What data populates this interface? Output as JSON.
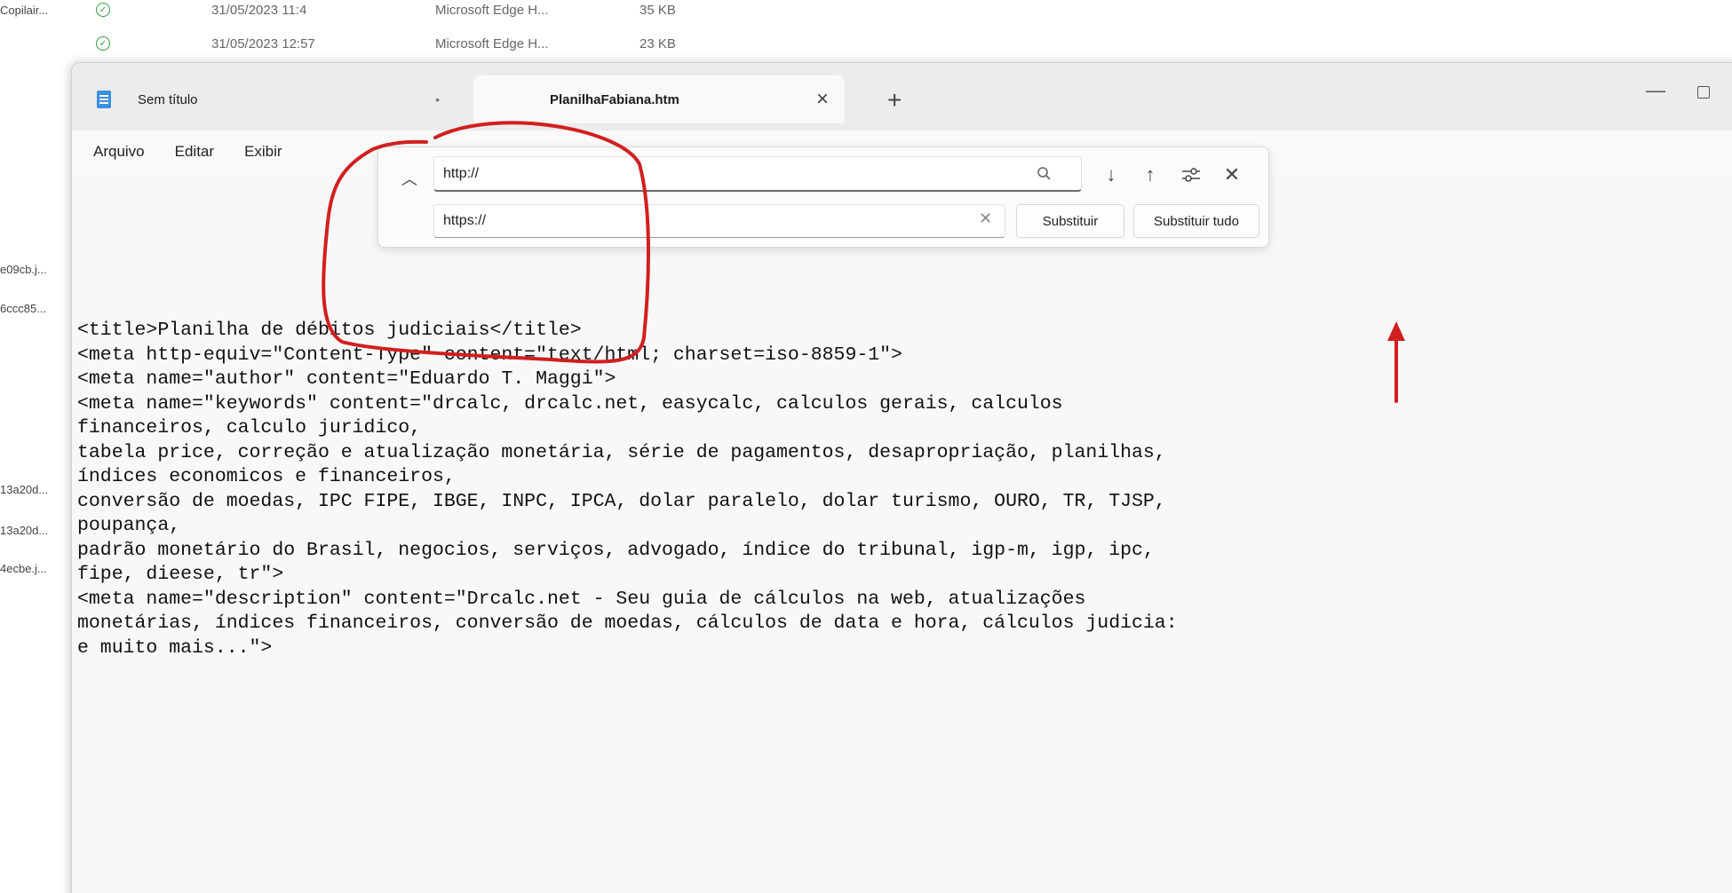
{
  "explorer": {
    "rows": [
      {
        "name": "Copilair...",
        "date": "31/05/2023 11:4",
        "type": "Microsoft Edge H...",
        "size": "35 KB"
      },
      {
        "name": "",
        "date": "31/05/2023 12:57",
        "type": "Microsoft Edge H...",
        "size": "23 KB"
      }
    ],
    "side_files": [
      "e09cb.j...",
      "6ccc85...",
      "13a20d...",
      "13a20d...",
      "4ecbe.j..."
    ]
  },
  "window": {
    "tabs": [
      {
        "label": "Sem título",
        "modified": "•"
      },
      {
        "label": "PlanilhaFabiana.htm"
      }
    ],
    "new_tab": "+",
    "menu": [
      "Arquivo",
      "Editar",
      "Exibir"
    ]
  },
  "find_replace": {
    "find_value": "http://",
    "replace_value": "https://",
    "replace_button": "Substituir",
    "replace_all_button": "Substituir tudo"
  },
  "editor": {
    "lines": [
      "<title>Planilha de débitos judiciais</title>",
      "<meta http-equiv=\"Content-Type\" content=\"text/html; charset=iso-8859-1\">",
      "<meta name=\"author\" content=\"Eduardo T. Maggi\">",
      "<meta name=\"keywords\" content=\"drcalc, drcalc.net, easycalc, calculos gerais, calculos",
      "financeiros, calculo juridico,",
      "tabela price, correção e atualização monetária, série de pagamentos, desapropriação, planilhas,",
      "índices economicos e financeiros,",
      "conversão de moedas, IPC FIPE, IBGE, INPC, IPCA, dolar paralelo, dolar turismo, OURO, TR, TJSP,",
      "poupança,",
      "padrão monetário do Brasil, negocios, serviços, advogado, índice do tribunal, igp-m, igp, ipc,",
      "fipe, dieese, tr\">",
      "<meta name=\"description\" content=\"Drcalc.net - Seu guia de cálculos na web, atualizações",
      "monetárias, índices financeiros, conversão de moedas, cálculos de data e hora, cálculos judicia:",
      "e muito mais...\">"
    ]
  },
  "colors": {
    "annotation": "#d11f1f",
    "doc_icon": "#3b8fe0"
  }
}
